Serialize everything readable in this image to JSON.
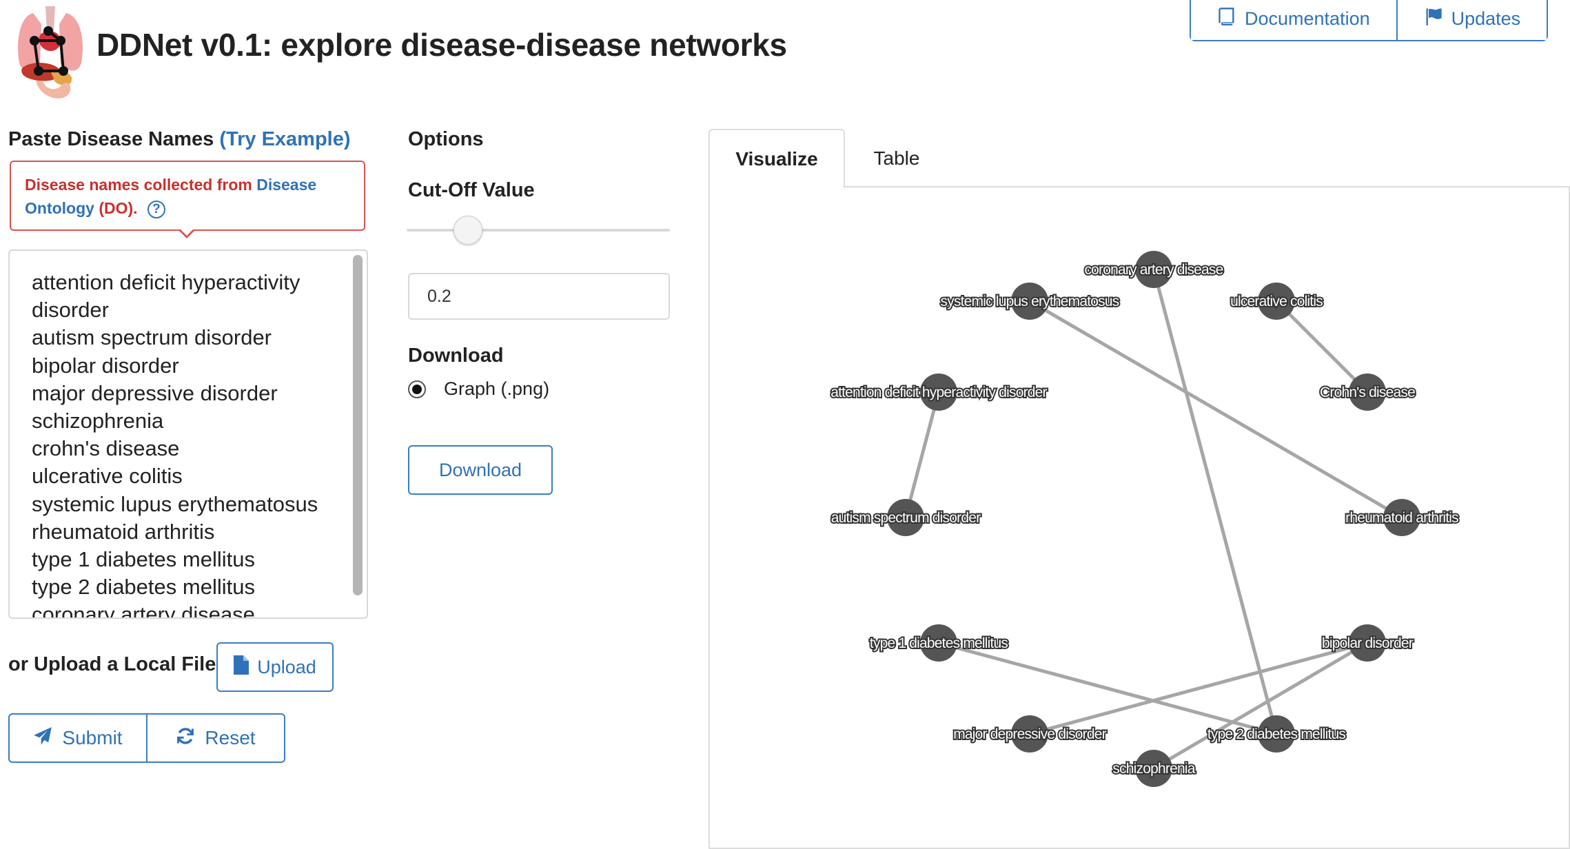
{
  "header": {
    "title": "DDNet v0.1: explore disease-disease networks",
    "nav": [
      {
        "label": "Documentation",
        "icon": "book-icon"
      },
      {
        "label": "Updates",
        "icon": "flag-icon"
      }
    ]
  },
  "input": {
    "label": "Paste Disease Names",
    "example_link": "(Try Example)",
    "callout": {
      "prefix": "Disease names collected from",
      "link": "Disease Ontology",
      "suffix": "(DO).",
      "help_icon": "?"
    },
    "textarea_lines": [
      "attention deficit hyperactivity",
      "disorder",
      "autism spectrum disorder",
      "bipolar disorder",
      "major depressive disorder",
      "schizophrenia",
      "crohn's disease",
      "ulcerative colitis",
      "systemic lupus erythematosus",
      "rheumatoid arthritis",
      "type 1 diabetes mellitus",
      "type 2 diabetes mellitus",
      "coronary artery disease"
    ],
    "upload_label": "or Upload a Local File:",
    "upload_button": "Upload",
    "submit_button": "Submit",
    "reset_button": "Reset"
  },
  "options": {
    "heading": "Options",
    "cutoff_label": "Cut-Off Value",
    "cutoff_value": "0.2",
    "slider_fraction": 0.2,
    "download_heading": "Download",
    "download_option": "Graph (.png)",
    "download_button": "Download"
  },
  "tabs": [
    {
      "label": "Visualize",
      "active": true
    },
    {
      "label": "Table",
      "active": false
    }
  ],
  "graph": {
    "node_color": "#555555",
    "edge_color": "#a6a6a6",
    "nodes": [
      {
        "id": "cad",
        "label": "coronary artery disease"
      },
      {
        "id": "sle",
        "label": "systemic lupus erythematosus"
      },
      {
        "id": "uc",
        "label": "ulcerative colitis"
      },
      {
        "id": "adhd",
        "label": "attention deficit hyperactivity disorder"
      },
      {
        "id": "crohn",
        "label": "Crohn's disease"
      },
      {
        "id": "asd",
        "label": "autism spectrum disorder"
      },
      {
        "id": "ra",
        "label": "rheumatoid arthritis"
      },
      {
        "id": "t1d",
        "label": "type 1 diabetes mellitus"
      },
      {
        "id": "bd",
        "label": "bipolar disorder"
      },
      {
        "id": "mdd",
        "label": "major depressive disorder"
      },
      {
        "id": "t2d",
        "label": "type 2 diabetes mellitus"
      },
      {
        "id": "scz",
        "label": "schizophrenia"
      }
    ],
    "edges": [
      [
        "cad",
        "t2d"
      ],
      [
        "sle",
        "ra"
      ],
      [
        "uc",
        "crohn"
      ],
      [
        "adhd",
        "asd"
      ],
      [
        "t1d",
        "t2d"
      ],
      [
        "bd",
        "mdd"
      ],
      [
        "bd",
        "scz"
      ]
    ]
  }
}
